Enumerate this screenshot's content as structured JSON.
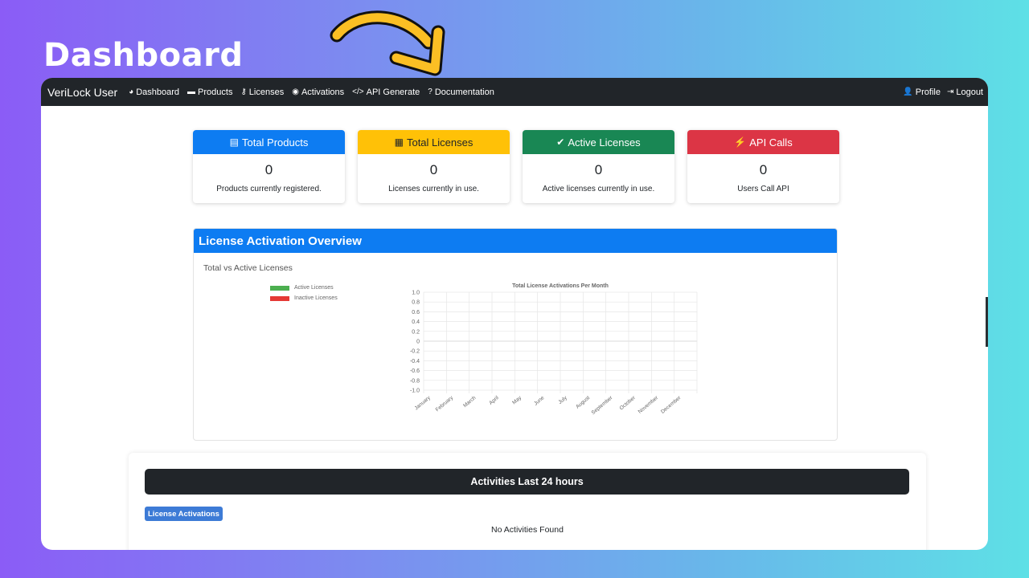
{
  "heading": "Dashboard",
  "nav": {
    "brand": "VeriLock User",
    "items": [
      {
        "icon": "dashboard-icon",
        "glyph": "◕",
        "label": "Dashboard"
      },
      {
        "icon": "products-icon",
        "glyph": "▬",
        "label": "Products"
      },
      {
        "icon": "key-icon",
        "glyph": "⚷",
        "label": "Licenses"
      },
      {
        "icon": "toggle-icon",
        "glyph": "◉",
        "label": "Activations"
      },
      {
        "icon": "code-icon",
        "glyph": "</>",
        "label": "API Generate"
      },
      {
        "icon": "question-icon",
        "glyph": "?",
        "label": "Documentation"
      }
    ],
    "right": [
      {
        "icon": "user-icon",
        "glyph": "👤",
        "label": "Profile"
      },
      {
        "icon": "logout-icon",
        "glyph": "⇥",
        "label": "Logout"
      }
    ]
  },
  "cards": [
    {
      "title": "Total Products",
      "icon": "box-icon",
      "glyph": "▤",
      "value": "0",
      "desc": "Products currently registered.",
      "color": "#0d7cf2"
    },
    {
      "title": "Total Licenses",
      "icon": "boxes-icon",
      "glyph": "▦",
      "value": "0",
      "desc": "Licenses currently in use.",
      "color": "#ffc107"
    },
    {
      "title": "Active Licenses",
      "icon": "check-circle-icon",
      "glyph": "✔",
      "value": "0",
      "desc": "Active licenses currently in use.",
      "color": "#198754"
    },
    {
      "title": "API Calls",
      "icon": "plug-icon",
      "glyph": "⚡",
      "value": "0",
      "desc": "Users Call API",
      "color": "#dc3545"
    }
  ],
  "overview": {
    "title": "License Activation Overview",
    "subtitle": "Total vs Active Licenses",
    "legend": [
      {
        "label": "Active Licenses",
        "color": "#4caf50"
      },
      {
        "label": "Inactive Licenses",
        "color": "#e53935"
      }
    ]
  },
  "chart_data": {
    "type": "line",
    "title": "Total License Activations Per Month",
    "categories": [
      "January",
      "February",
      "March",
      "April",
      "May",
      "June",
      "July",
      "August",
      "September",
      "October",
      "November",
      "December"
    ],
    "ylim": [
      -1.0,
      1.0
    ],
    "yticks": [
      "1.0",
      "0.8",
      "0.6",
      "0.4",
      "0.2",
      "0",
      "-0.2",
      "-0.4",
      "-0.6",
      "-0.8",
      "-1.0"
    ],
    "series": [],
    "grid": true
  },
  "activities": {
    "title": "Activities Last 24 hours",
    "badge": "License Activations",
    "empty": "No Activities Found"
  }
}
